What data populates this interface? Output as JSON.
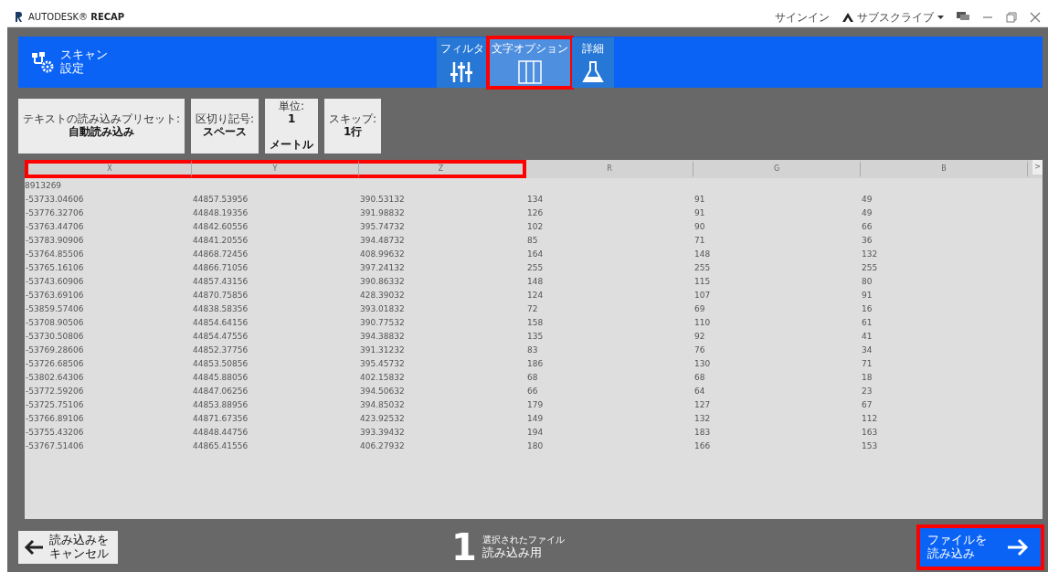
{
  "window": {
    "app_name": "AUTODESK® **RECAP**",
    "sign_in": "サインイン",
    "subscribe": "サブスクライブ"
  },
  "header": {
    "title_lines": [
      "スキャン",
      "設定"
    ],
    "tabs": [
      {
        "label": "フィルタ",
        "kind": "sliders",
        "selected": false,
        "highlighted": false
      },
      {
        "label": "文字オプション",
        "kind": "columns",
        "selected": true,
        "highlighted": true
      },
      {
        "label": "詳細",
        "kind": "flask",
        "selected": false,
        "highlighted": false
      }
    ]
  },
  "options": [
    {
      "label": "テキストの読み込みプリセット:",
      "value_lines": [
        "自動読み込み"
      ]
    },
    {
      "label": "区切り記号:",
      "value_lines": [
        "スペース"
      ]
    },
    {
      "label": "単位:",
      "value_lines": [
        "1",
        "メートル"
      ]
    },
    {
      "label": "スキップ:",
      "value_lines": [
        "1行"
      ]
    }
  ],
  "table": {
    "columns": [
      {
        "label": "X",
        "highlighted": true
      },
      {
        "label": "Y",
        "highlighted": true
      },
      {
        "label": "Z",
        "highlighted": true
      },
      {
        "label": "R",
        "highlighted": false
      },
      {
        "label": "G",
        "highlighted": false
      },
      {
        "label": "B",
        "highlighted": false
      }
    ],
    "scroll_right": ">",
    "first_line": "8913269",
    "rows": [
      [
        "-53733.04606",
        "44857.53956",
        "390.53132",
        "134",
        "91",
        "49"
      ],
      [
        "-53776.32706",
        "44848.19356",
        "391.98832",
        "126",
        "91",
        "49"
      ],
      [
        "-53763.44706",
        "44842.60556",
        "395.74732",
        "102",
        "90",
        "66"
      ],
      [
        "-53783.90906",
        "44841.20556",
        "394.48732",
        "85",
        "71",
        "36"
      ],
      [
        "-53764.85506",
        "44868.72456",
        "408.99632",
        "164",
        "148",
        "132"
      ],
      [
        "-53765.16106",
        "44866.71056",
        "397.24132",
        "255",
        "255",
        "255"
      ],
      [
        "-53743.60906",
        "44857.43156",
        "390.86332",
        "148",
        "115",
        "80"
      ],
      [
        "-53763.69106",
        "44870.75856",
        "428.39032",
        "124",
        "107",
        "91"
      ],
      [
        "-53859.57406",
        "44838.58356",
        "393.01832",
        "72",
        "69",
        "16"
      ],
      [
        "-53708.90506",
        "44854.64156",
        "390.77532",
        "158",
        "110",
        "61"
      ],
      [
        "-53730.50806",
        "44854.47556",
        "394.38832",
        "135",
        "92",
        "41"
      ],
      [
        "-53769.28606",
        "44852.37756",
        "391.31232",
        "83",
        "76",
        "34"
      ],
      [
        "-53726.68506",
        "44853.50856",
        "395.45732",
        "186",
        "130",
        "71"
      ],
      [
        "-53802.64306",
        "44845.88056",
        "402.15832",
        "68",
        "68",
        "18"
      ],
      [
        "-53772.59206",
        "44847.06256",
        "394.50632",
        "66",
        "64",
        "23"
      ],
      [
        "-53725.75106",
        "44853.88956",
        "394.85032",
        "179",
        "127",
        "67"
      ],
      [
        "-53766.89106",
        "44871.67356",
        "423.92532",
        "149",
        "132",
        "112"
      ],
      [
        "-53755.43206",
        "44848.44756",
        "393.39432",
        "194",
        "183",
        "163"
      ],
      [
        "-53767.51406",
        "44865.41556",
        "406.27932",
        "180",
        "166",
        "153"
      ]
    ]
  },
  "footer": {
    "cancel_lines": [
      "読み込みを",
      "キャンセル"
    ],
    "count": "1",
    "file_lines": [
      "選択されたファイル",
      "読み込み用"
    ],
    "import_lines": [
      "ファイルを",
      "読み込み"
    ],
    "import_highlighted": true
  }
}
